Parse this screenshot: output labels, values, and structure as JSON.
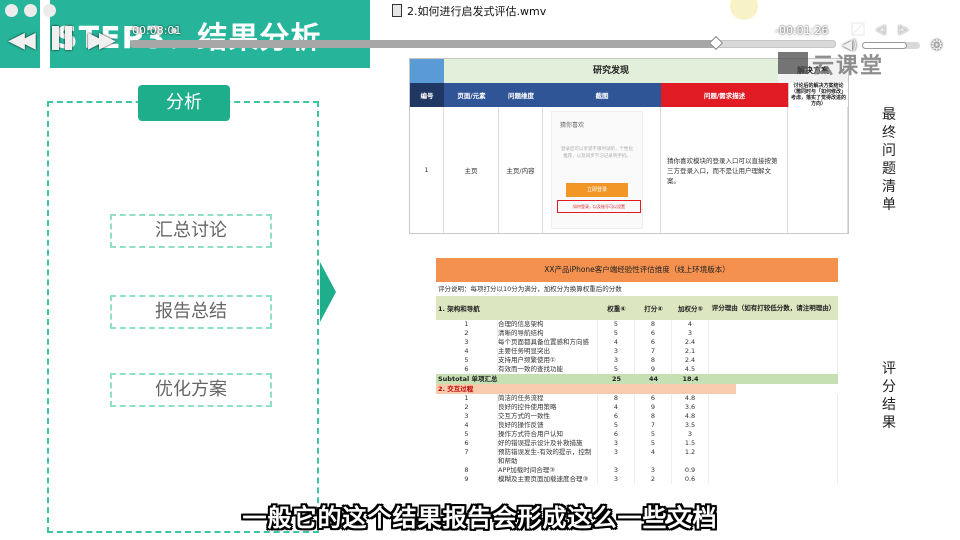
{
  "player": {
    "window_title": "2.如何进行启发式评估.wmv",
    "elapsed": "00:08:01",
    "remaining": "-00:01:26",
    "progress": 0.83,
    "volume": 0.78
  },
  "watermark": {
    "text": "云课堂"
  },
  "slide": {
    "step_title": "STEP3：结果分析",
    "badge": "分析",
    "options": [
      "汇总讨论",
      "报告总结",
      "优化方案"
    ],
    "side_label_top": [
      "最",
      "终",
      "问",
      "题",
      "清",
      "单"
    ],
    "side_label_bottom": [
      "评",
      "分",
      "结",
      "果"
    ],
    "accent_color": "#26b59a"
  },
  "findings": {
    "group_research": "研究发现",
    "group_solution": "解决方案",
    "headers": {
      "no": "编号",
      "page": "页面/元素",
      "dimension": "问题维度",
      "screenshot": "截图",
      "issue": "问题/需求描述",
      "solution": "讨论后的解决方案结论（需同时与「如何修改」考虑，落实了觉得改进的方向）"
    },
    "row": {
      "no": "1",
      "page": "主页",
      "dimension": "主页/内容",
      "mock_title": "猜你喜欢",
      "mock_desc": "登录后可以享受不限时试听，个性化推荐，以及同步学习记录到手机。",
      "mock_button": "立即登录",
      "mock_redbox": "如何登录，以及账号可以设置",
      "issue": "猜你喜欢模块的登录入口可以直接按第三方登录入口，而不是让用户理解文案。"
    }
  },
  "score": {
    "title": "XX产品iPhone客户端经验性评估维度（线上环境版本）",
    "desc": "评分说明：每项打分以10分为满分，加权分为换算权重后的分数",
    "header": {
      "section": "1. 架构和导航",
      "weight": "权重④",
      "score": "打分④",
      "weighted": "加权分⑤",
      "reason": "评分理由（如有打较低分数，请注明理由）"
    },
    "section1": [
      {
        "no": "1",
        "item": "合理的信息架构",
        "w": "5",
        "s": "8",
        "ws": "4"
      },
      {
        "no": "2",
        "item": "清晰的导航结构",
        "w": "5",
        "s": "6",
        "ws": "3"
      },
      {
        "no": "3",
        "item": "每个页面都具备位置感和方向感",
        "w": "4",
        "s": "6",
        "ws": "2.4"
      },
      {
        "no": "4",
        "item": "主要任务明显突出",
        "w": "3",
        "s": "7",
        "ws": "2.1"
      },
      {
        "no": "5",
        "item": "支持用户频繁使用①",
        "w": "3",
        "s": "8",
        "ws": "2.4"
      },
      {
        "no": "6",
        "item": "有效而一致的查找功能",
        "w": "5",
        "s": "9",
        "ws": "4.5"
      }
    ],
    "subtotal": {
      "label": "Subtotal 单项汇总",
      "w": "25",
      "s": "44",
      "ws": "18.4"
    },
    "section2_title": "2. 交互过程",
    "section2": [
      {
        "no": "1",
        "item": "简洁的任务流程",
        "w": "8",
        "s": "6",
        "ws": "4.8"
      },
      {
        "no": "2",
        "item": "良好的控件使用策略",
        "w": "4",
        "s": "9",
        "ws": "3.6"
      },
      {
        "no": "3",
        "item": "交互方式的一致性",
        "w": "6",
        "s": "8",
        "ws": "4.8"
      },
      {
        "no": "4",
        "item": "良好的操作反馈",
        "w": "5",
        "s": "7",
        "ws": "3.5"
      },
      {
        "no": "5",
        "item": "操作方式符合用户认知",
        "w": "6",
        "s": "5",
        "ws": "3"
      },
      {
        "no": "6",
        "item": "好的错误提示设计及补救措施",
        "w": "3",
        "s": "5",
        "ws": "1.5"
      },
      {
        "no": "7",
        "item": "预防错误发生-有效的提示，控制和帮助",
        "w": "3",
        "s": "4",
        "ws": "1.2",
        "tall": true
      },
      {
        "no": "8",
        "item": "APP加载时间合理③",
        "w": "3",
        "s": "3",
        "ws": "0.9"
      },
      {
        "no": "9",
        "item": "模糊及主要页面加载速度合理③",
        "w": "3",
        "s": "2",
        "ws": "0.6"
      }
    ]
  },
  "subtitle": "一般它的这个结果报告会形成这么一些文档"
}
